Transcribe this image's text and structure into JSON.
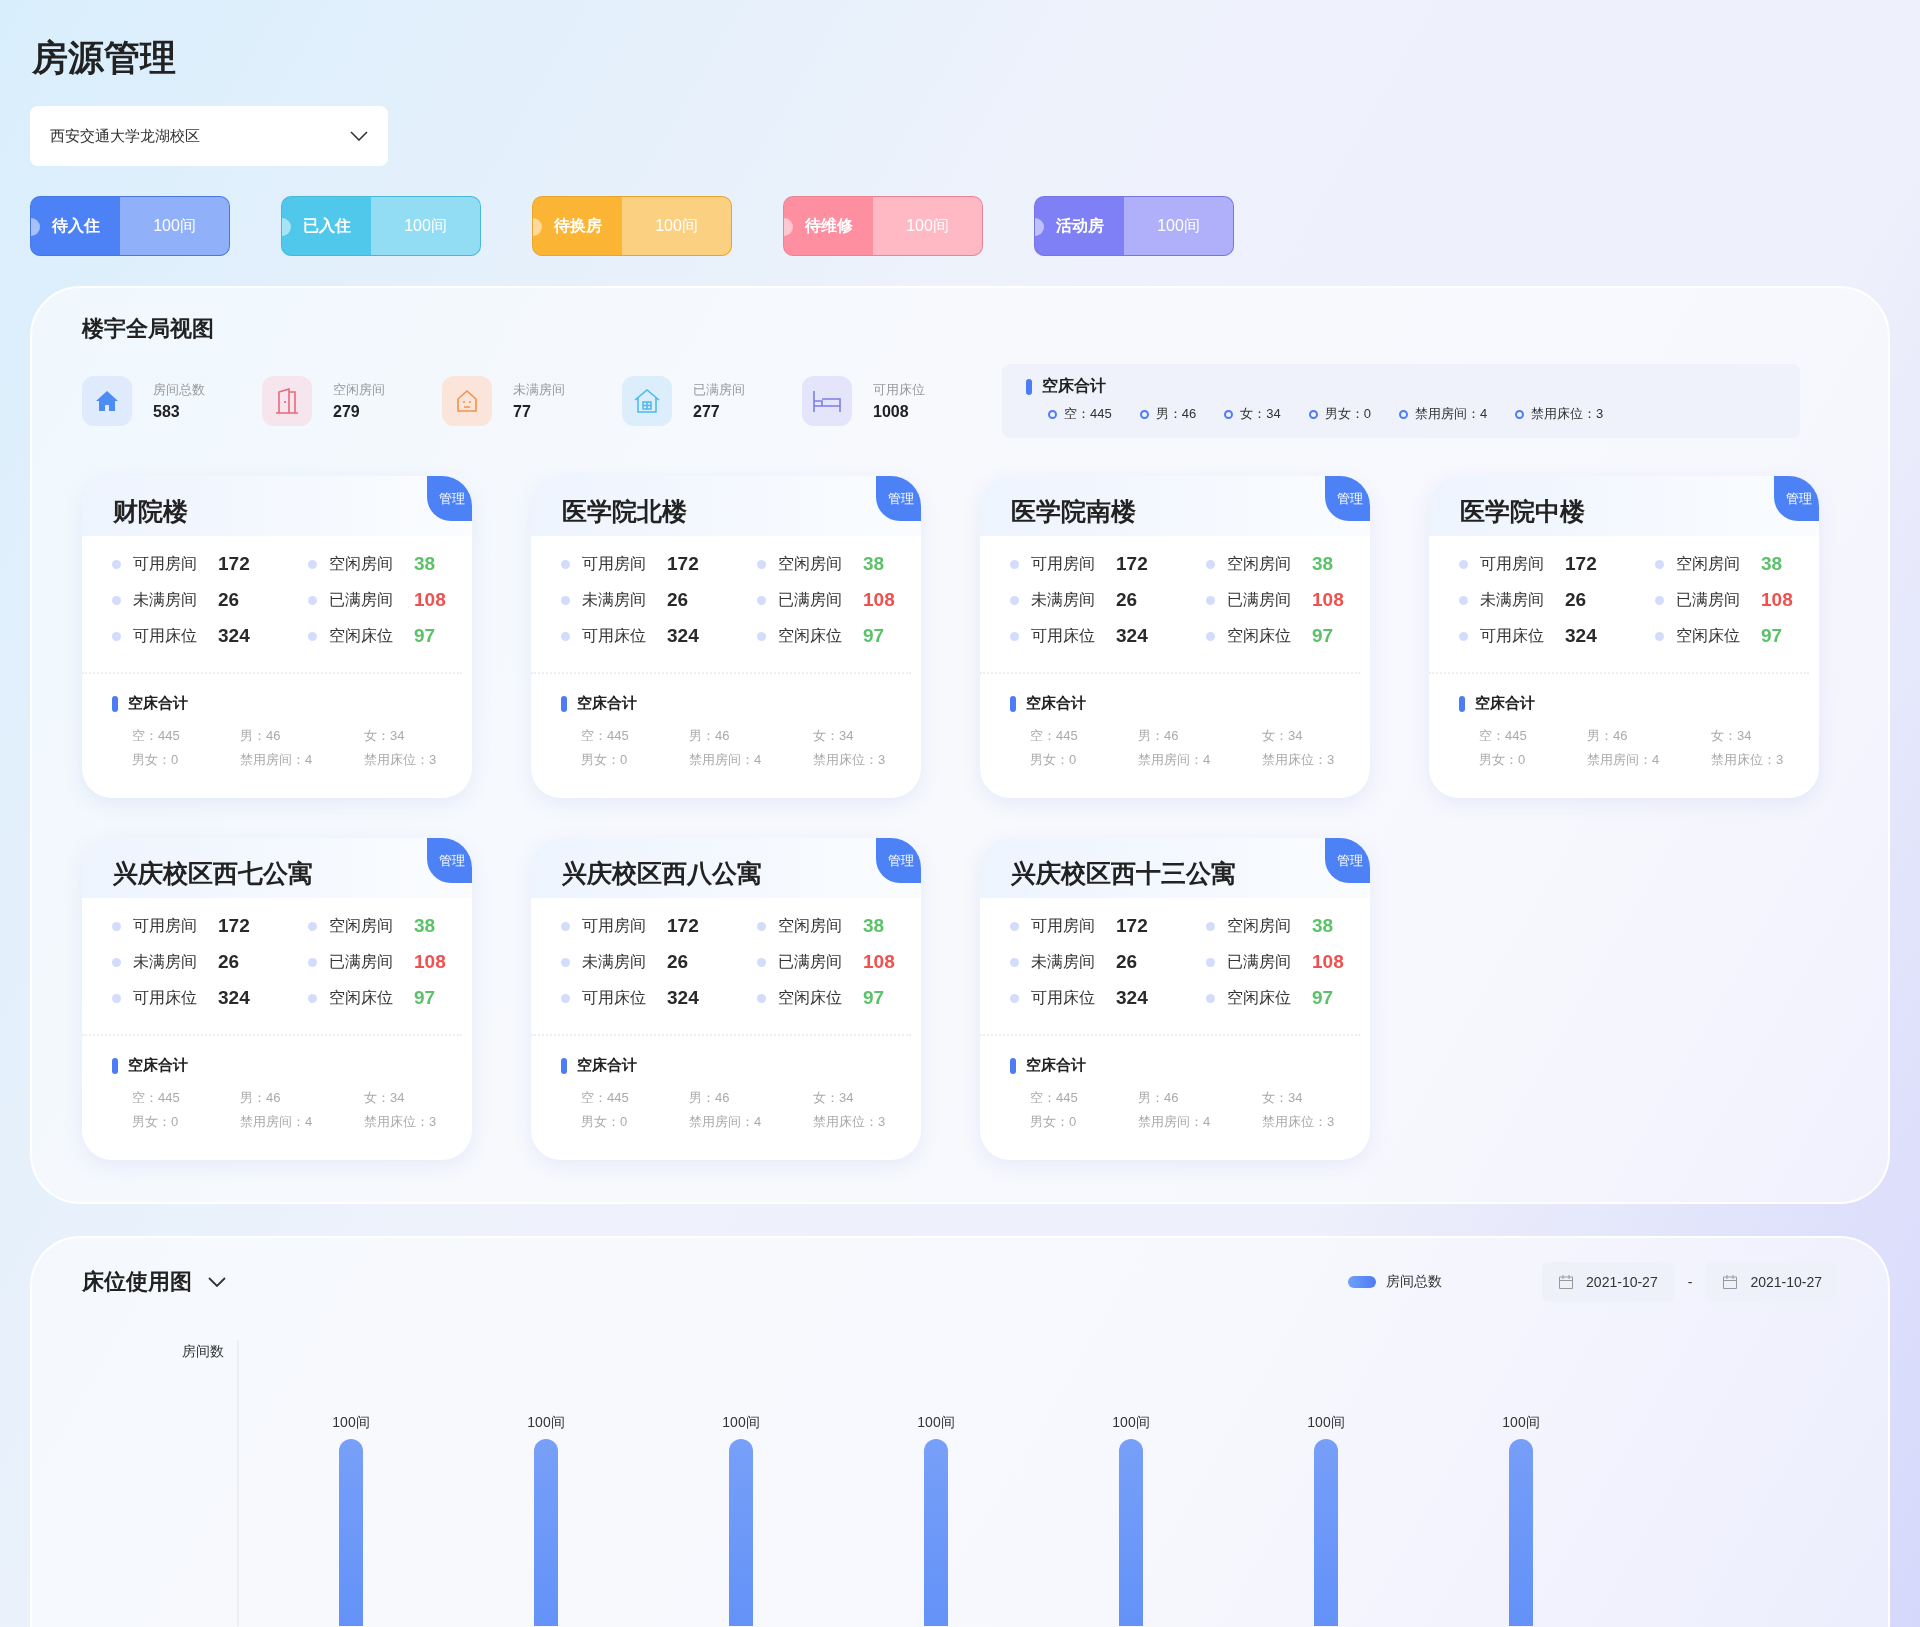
{
  "page_title": "房源管理",
  "campus_select": {
    "value": "西安交通大学龙湖校区"
  },
  "status_buttons": [
    {
      "label": "待入住",
      "count": "100间",
      "color": "#4d82f7"
    },
    {
      "label": "已入住",
      "count": "100间",
      "color": "#4fc8ec"
    },
    {
      "label": "待换房",
      "count": "100间",
      "color": "#fbb434"
    },
    {
      "label": "待维修",
      "count": "100间",
      "color": "#fe8fa0"
    },
    {
      "label": "活动房",
      "count": "100间",
      "color": "#7f80f6"
    }
  ],
  "overview": {
    "title": "楼宇全局视图",
    "stats": [
      {
        "kind": "rooms",
        "label": "房间总数",
        "value": "583"
      },
      {
        "kind": "vacant",
        "label": "空闲房间",
        "value": "279"
      },
      {
        "kind": "partial",
        "label": "未满房间",
        "value": "77"
      },
      {
        "kind": "full",
        "label": "已满房间",
        "value": "277"
      },
      {
        "kind": "beds",
        "label": "可用床位",
        "value": "1008"
      }
    ],
    "empty_beds": {
      "title": "空床合计",
      "items": [
        "空：445",
        "男：46",
        "女：34",
        "男女：0",
        "禁用房间：4",
        "禁用床位：3"
      ]
    }
  },
  "buildings": [
    {
      "name": "财院楼",
      "action": "管理",
      "metrics": [
        {
          "label": "可用房间",
          "value": "172",
          "kind": "plain"
        },
        {
          "label": "空闲房间",
          "value": "38",
          "kind": "good"
        },
        {
          "label": "未满房间",
          "value": "26",
          "kind": "plain"
        },
        {
          "label": "已满房间",
          "value": "108",
          "kind": "bad"
        },
        {
          "label": "可用床位",
          "value": "324",
          "kind": "plain"
        },
        {
          "label": "空闲床位",
          "value": "97",
          "kind": "good"
        }
      ],
      "empty_beds": {
        "title": "空床合计",
        "items": [
          "空：445",
          "男：46",
          "女：34",
          "男女：0",
          "禁用房间：4",
          "禁用床位：3"
        ]
      }
    },
    {
      "name": "医学院北楼",
      "action": "管理",
      "metrics": [
        {
          "label": "可用房间",
          "value": "172",
          "kind": "plain"
        },
        {
          "label": "空闲房间",
          "value": "38",
          "kind": "good"
        },
        {
          "label": "未满房间",
          "value": "26",
          "kind": "plain"
        },
        {
          "label": "已满房间",
          "value": "108",
          "kind": "bad"
        },
        {
          "label": "可用床位",
          "value": "324",
          "kind": "plain"
        },
        {
          "label": "空闲床位",
          "value": "97",
          "kind": "good"
        }
      ],
      "empty_beds": {
        "title": "空床合计",
        "items": [
          "空：445",
          "男：46",
          "女：34",
          "男女：0",
          "禁用房间：4",
          "禁用床位：3"
        ]
      }
    },
    {
      "name": "医学院南楼",
      "action": "管理",
      "metrics": [
        {
          "label": "可用房间",
          "value": "172",
          "kind": "plain"
        },
        {
          "label": "空闲房间",
          "value": "38",
          "kind": "good"
        },
        {
          "label": "未满房间",
          "value": "26",
          "kind": "plain"
        },
        {
          "label": "已满房间",
          "value": "108",
          "kind": "bad"
        },
        {
          "label": "可用床位",
          "value": "324",
          "kind": "plain"
        },
        {
          "label": "空闲床位",
          "value": "97",
          "kind": "good"
        }
      ],
      "empty_beds": {
        "title": "空床合计",
        "items": [
          "空：445",
          "男：46",
          "女：34",
          "男女：0",
          "禁用房间：4",
          "禁用床位：3"
        ]
      }
    },
    {
      "name": "医学院中楼",
      "action": "管理",
      "metrics": [
        {
          "label": "可用房间",
          "value": "172",
          "kind": "plain"
        },
        {
          "label": "空闲房间",
          "value": "38",
          "kind": "good"
        },
        {
          "label": "未满房间",
          "value": "26",
          "kind": "plain"
        },
        {
          "label": "已满房间",
          "value": "108",
          "kind": "bad"
        },
        {
          "label": "可用床位",
          "value": "324",
          "kind": "plain"
        },
        {
          "label": "空闲床位",
          "value": "97",
          "kind": "good"
        }
      ],
      "empty_beds": {
        "title": "空床合计",
        "items": [
          "空：445",
          "男：46",
          "女：34",
          "男女：0",
          "禁用房间：4",
          "禁用床位：3"
        ]
      }
    },
    {
      "name": "兴庆校区西七公寓",
      "action": "管理",
      "metrics": [
        {
          "label": "可用房间",
          "value": "172",
          "kind": "plain"
        },
        {
          "label": "空闲房间",
          "value": "38",
          "kind": "good"
        },
        {
          "label": "未满房间",
          "value": "26",
          "kind": "plain"
        },
        {
          "label": "已满房间",
          "value": "108",
          "kind": "bad"
        },
        {
          "label": "可用床位",
          "value": "324",
          "kind": "plain"
        },
        {
          "label": "空闲床位",
          "value": "97",
          "kind": "good"
        }
      ],
      "empty_beds": {
        "title": "空床合计",
        "items": [
          "空：445",
          "男：46",
          "女：34",
          "男女：0",
          "禁用房间：4",
          "禁用床位：3"
        ]
      }
    },
    {
      "name": "兴庆校区西八公寓",
      "action": "管理",
      "metrics": [
        {
          "label": "可用房间",
          "value": "172",
          "kind": "plain"
        },
        {
          "label": "空闲房间",
          "value": "38",
          "kind": "good"
        },
        {
          "label": "未满房间",
          "value": "26",
          "kind": "plain"
        },
        {
          "label": "已满房间",
          "value": "108",
          "kind": "bad"
        },
        {
          "label": "可用床位",
          "value": "324",
          "kind": "plain"
        },
        {
          "label": "空闲床位",
          "value": "97",
          "kind": "good"
        }
      ],
      "empty_beds": {
        "title": "空床合计",
        "items": [
          "空：445",
          "男：46",
          "女：34",
          "男女：0",
          "禁用房间：4",
          "禁用床位：3"
        ]
      }
    },
    {
      "name": "兴庆校区西十三公寓",
      "action": "管理",
      "metrics": [
        {
          "label": "可用房间",
          "value": "172",
          "kind": "plain"
        },
        {
          "label": "空闲房间",
          "value": "38",
          "kind": "good"
        },
        {
          "label": "未满房间",
          "value": "26",
          "kind": "plain"
        },
        {
          "label": "已满房间",
          "value": "108",
          "kind": "bad"
        },
        {
          "label": "可用床位",
          "value": "324",
          "kind": "plain"
        },
        {
          "label": "空闲床位",
          "value": "97",
          "kind": "good"
        }
      ],
      "empty_beds": {
        "title": "空床合计",
        "items": [
          "空：445",
          "男：46",
          "女：34",
          "男女：0",
          "禁用房间：4",
          "禁用床位：3"
        ]
      }
    }
  ],
  "usage_chart": {
    "title": "床位使用图",
    "date_from": "2021-10-27",
    "date_separator": "-",
    "date_to": "2021-10-27",
    "legend": "房间总数",
    "axis_title": "房间数",
    "bar_labels": [
      "100间",
      "100间",
      "100间",
      "100间",
      "100间",
      "100间",
      "100间"
    ]
  }
}
